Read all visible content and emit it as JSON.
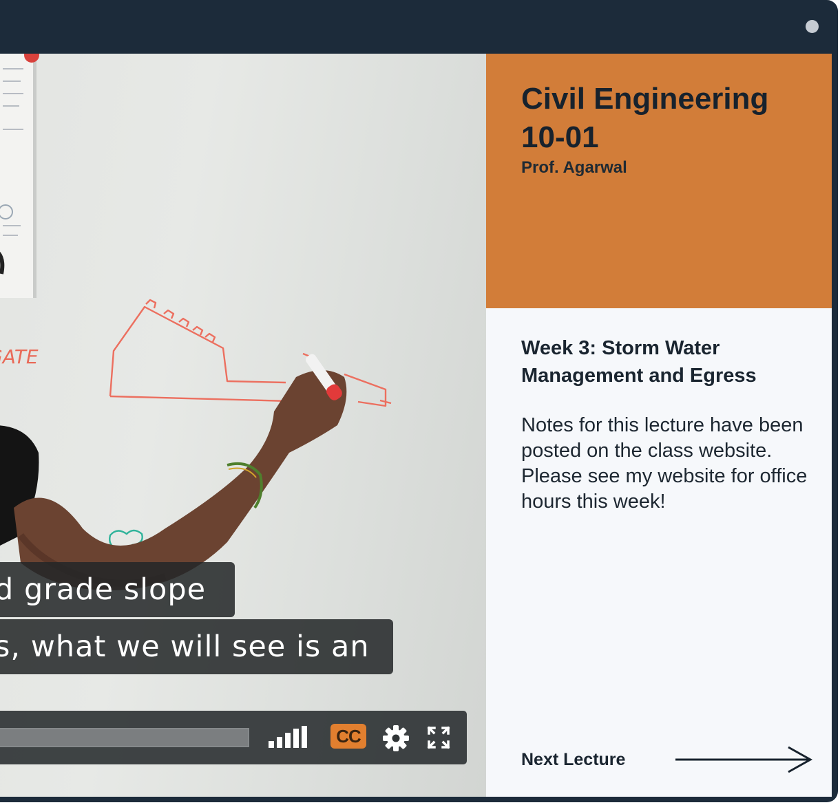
{
  "course": {
    "title": "Civil Engineering 10-01",
    "professor": "Prof. Agarwal"
  },
  "lecture": {
    "week_title": "Week 3: Storm Water Management and Egress",
    "notes": "Notes for this lecture have been posted on the class website. Please see my website for office hours this week!"
  },
  "navigation": {
    "next_label": "Next Lecture"
  },
  "video": {
    "whiteboard_text": "GATE",
    "captions": [
      "d grade slope",
      "s, what we will see is an"
    ],
    "controls": {
      "cc_label": "CC",
      "icons": [
        "volume-bars-icon",
        "closed-captions-icon",
        "gear-icon",
        "fullscreen-icon"
      ]
    }
  },
  "colors": {
    "frame": "#1c2b3a",
    "accent": "#d27d39",
    "cc_accent": "#e17f2f",
    "panel_background": "#f6f8fb"
  }
}
